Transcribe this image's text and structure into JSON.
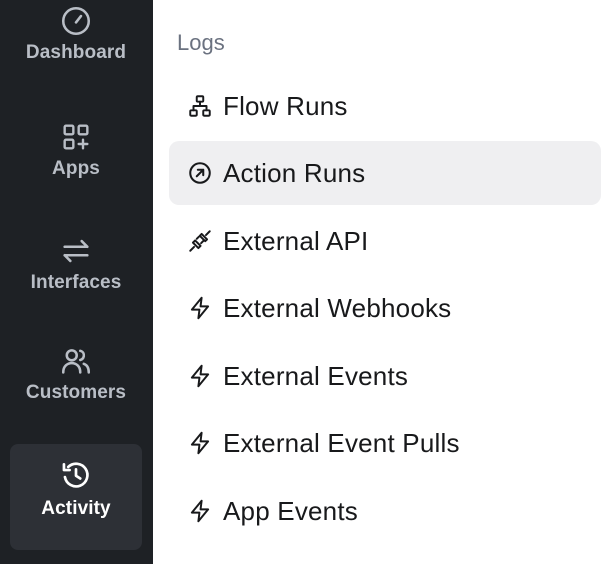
{
  "rail": {
    "items": [
      {
        "label": "Dashboard",
        "icon": "gauge-icon"
      },
      {
        "label": "Apps",
        "icon": "apps-grid-icon"
      },
      {
        "label": "Interfaces",
        "icon": "arrows-left-right-icon"
      },
      {
        "label": "Customers",
        "icon": "users-icon"
      },
      {
        "label": "Activity",
        "icon": "history-icon",
        "active": true
      }
    ]
  },
  "logs": {
    "heading": "Logs",
    "items": [
      {
        "label": "Flow Runs",
        "icon": "flow-tree-icon"
      },
      {
        "label": "Action Runs",
        "icon": "circle-arrow-up-right-icon",
        "active": true
      },
      {
        "label": "External API",
        "icon": "plug-icon"
      },
      {
        "label": "External Webhooks",
        "icon": "lightning-icon"
      },
      {
        "label": "External Events",
        "icon": "lightning-icon"
      },
      {
        "label": "External Event Pulls",
        "icon": "lightning-icon"
      },
      {
        "label": "App Events",
        "icon": "lightning-icon"
      }
    ]
  },
  "colors": {
    "rail_bg": "#1e2125",
    "rail_active_bg": "#2d3036",
    "rail_text": "#b9bec6",
    "active_item_bg": "#efeff1",
    "heading_text": "#6b7280"
  }
}
